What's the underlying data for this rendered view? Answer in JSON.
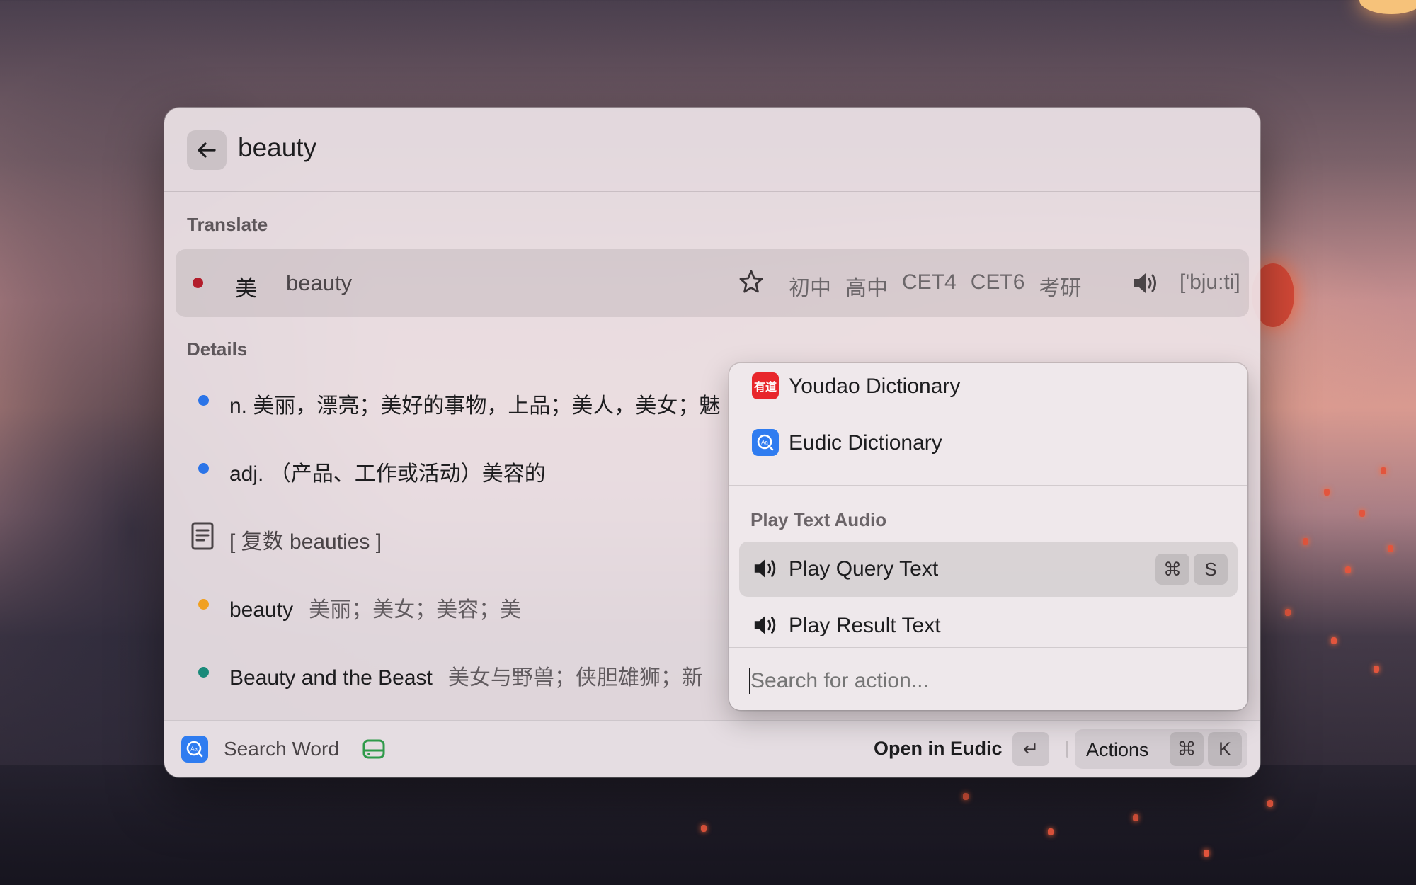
{
  "search_bar": {
    "query": "beauty",
    "back_icon": "arrow-left-icon"
  },
  "translate": {
    "section_label": "Translate",
    "dot_color": "#b31d2b",
    "translation": "美",
    "source": "beauty",
    "tags": [
      "初中",
      "高中",
      "CET4",
      "CET6",
      "考研"
    ],
    "phonetic": "['bju:ti]"
  },
  "details": {
    "section_label": "Details",
    "items": [
      {
        "text": "n. 美丽，漂亮；美好的事物，上品；美人，美女；魅",
        "sub": "",
        "dot_color": "#2b74e8"
      },
      {
        "text": "adj. （产品、工作或活动）美容的",
        "sub": "",
        "dot_color": "#2b74e8"
      },
      {
        "text": "[ 复数 beauties ]",
        "sub": "",
        "icon": "note-icon"
      },
      {
        "text": "beauty",
        "sub": "美丽；美女；美容；美",
        "dot_color": "#f0a020"
      },
      {
        "text": "Beauty and the Beast",
        "sub": "美女与野兽；侠胆雄狮；新",
        "dot_color": "#1a8a7a"
      }
    ]
  },
  "footer": {
    "search_label": "Search Word",
    "open_label": "Open in Eudic",
    "enter_key": "↵",
    "actions_label": "Actions",
    "cmd_key": "⌘",
    "k_key": "K"
  },
  "action_panel": {
    "youdao_label": "Youdao Dictionary",
    "youdao_badge": "有道",
    "eudic_label": "Eudic Dictionary",
    "section_label": "Play Text Audio",
    "play_query_label": "Play Query Text",
    "play_query_keys": [
      "⌘",
      "S"
    ],
    "play_result_label": "Play Result Text",
    "search_placeholder": "Search for action..."
  },
  "colors": {
    "accent_blue": "#2f7cf0",
    "youdao_red": "#e8262b"
  }
}
